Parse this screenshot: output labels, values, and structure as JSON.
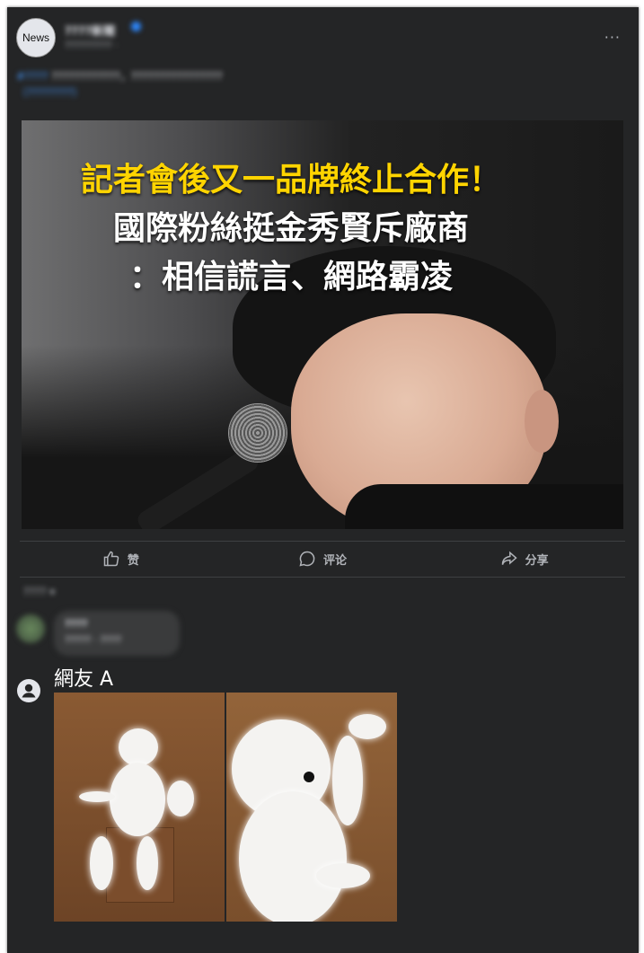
{
  "post": {
    "avatar_label": "News",
    "page_name": "????新聞",
    "meta": "????????? · ",
    "more": "···",
    "caption_link": "#????",
    "caption_text": "????????????，????????????????",
    "caption_second": "（????????）"
  },
  "image": {
    "headline_line1": "記者會後又一品牌終止合作！",
    "headline_line2": "國際粉絲挺金秀賢斥廠商",
    "headline_line3": "：相信謊言、網路霸凌"
  },
  "actions": {
    "like_label": "赞",
    "like_icon": "thumbs-up-icon",
    "comment_label": "评论",
    "comment_icon": "comment-icon",
    "share_label": "分享",
    "share_icon": "share-icon"
  },
  "comments": {
    "sort_label": "????",
    "first": {
      "name": "????",
      "text": "????? · ????"
    },
    "meme_comment": {
      "name": "網友 A",
      "icon": "user-icon"
    }
  },
  "colors": {
    "surface": "#242526",
    "headline_yellow": "#ffd400",
    "text_secondary": "#b0b3b8"
  }
}
